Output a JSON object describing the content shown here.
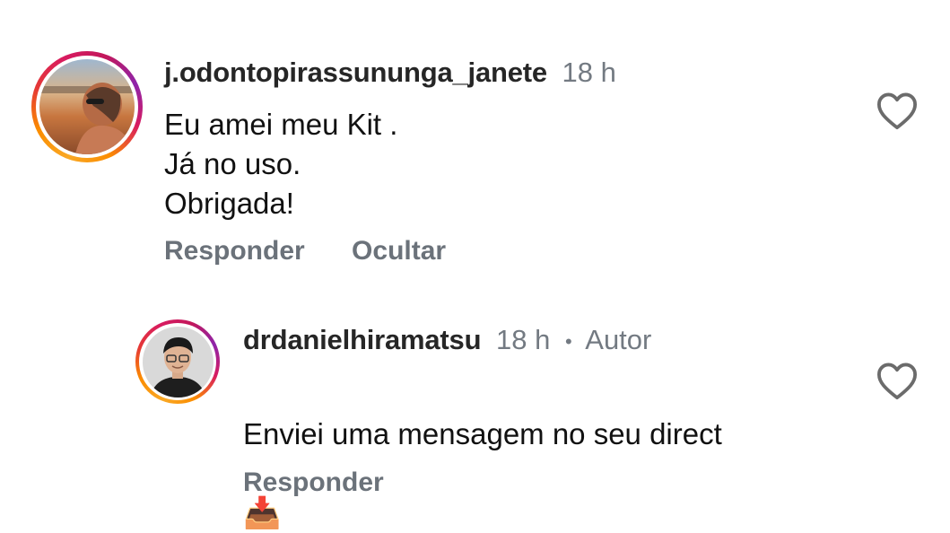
{
  "comments": [
    {
      "username": "j.odontopirassununga_janete",
      "time": "18 h",
      "text": "Eu amei meu Kit .\nJá no uso.\nObrigada!",
      "actions": {
        "reply": "Responder",
        "hide": "Ocultar"
      }
    },
    {
      "username": "drdanielhiramatsu",
      "time": "18 h",
      "separator": "•",
      "author_badge": "Autor",
      "text": "Enviei uma mensagem no seu direct",
      "emoji": "📥",
      "actions": {
        "reply": "Responder"
      }
    }
  ],
  "icons": {
    "like": "heart-outline-icon",
    "inbox_emoji": "inbox-tray-icon"
  },
  "colors": {
    "story_ring_start": "#f9a825",
    "story_ring_end": "#c2185b",
    "secondary_text": "#737a82",
    "action_text": "#6b727a"
  }
}
